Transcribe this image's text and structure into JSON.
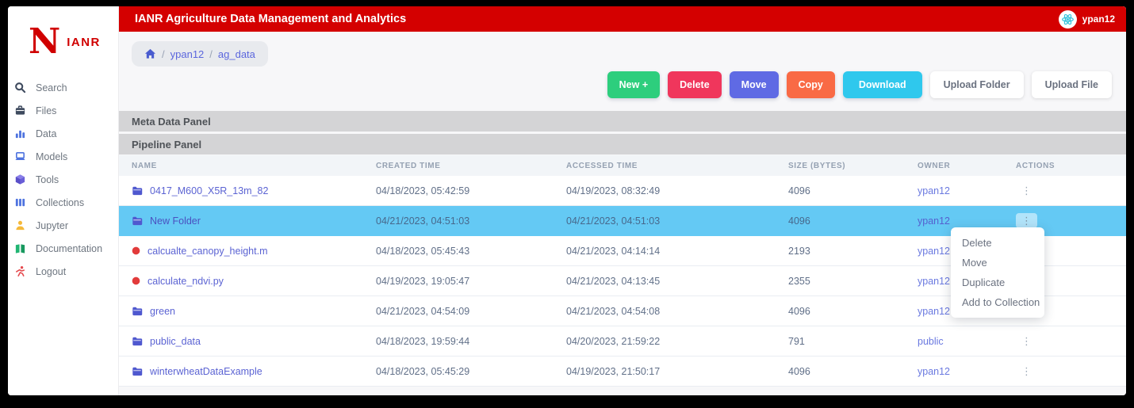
{
  "logo": {
    "letter": "N",
    "text": "IANR"
  },
  "header": {
    "title": "IANR Agriculture Data Management and Analytics",
    "username": "ypan12"
  },
  "sidebar": {
    "items": [
      {
        "icon": "search-icon",
        "label": "Search"
      },
      {
        "icon": "files-icon",
        "label": "Files"
      },
      {
        "icon": "data-icon",
        "label": "Data"
      },
      {
        "icon": "models-icon",
        "label": "Models"
      },
      {
        "icon": "tools-icon",
        "label": "Tools"
      },
      {
        "icon": "collections-icon",
        "label": "Collections"
      },
      {
        "icon": "jupyter-icon",
        "label": "Jupyter"
      },
      {
        "icon": "documentation-icon",
        "label": "Documentation"
      },
      {
        "icon": "logout-icon",
        "label": "Logout"
      }
    ]
  },
  "breadcrumb": {
    "sep": "/",
    "items": [
      "ypan12",
      "ag_data"
    ]
  },
  "toolbar": {
    "buttons": [
      {
        "label": "New +",
        "color": "#2dce7d"
      },
      {
        "label": "Delete",
        "color": "#f0365c"
      },
      {
        "label": "Move",
        "color": "#5f6ae4"
      },
      {
        "label": "Copy",
        "color": "#f96a45"
      },
      {
        "label": "Download",
        "color": "#2fc8ed"
      },
      {
        "label": "Upload Folder",
        "color": "#ffffff"
      },
      {
        "label": "Upload File",
        "color": "#ffffff"
      }
    ]
  },
  "panels": {
    "meta_label": "Meta Data Panel",
    "pipeline_label": "Pipeline Panel"
  },
  "table": {
    "columns": [
      "NAME",
      "CREATED TIME",
      "ACCESSED TIME",
      "SIZE (BYTES)",
      "OWNER",
      "ACTIONS"
    ],
    "rows": [
      {
        "name": "0417_M600_X5R_13m_82",
        "type": "folder",
        "created": "04/18/2023, 05:42:59",
        "accessed": "04/19/2023, 08:32:49",
        "size": "4096",
        "owner": "ypan12",
        "selected": false
      },
      {
        "name": "New Folder",
        "type": "folder",
        "created": "04/21/2023, 04:51:03",
        "accessed": "04/21/2023, 04:51:03",
        "size": "4096",
        "owner": "ypan12",
        "selected": true
      },
      {
        "name": "calcualte_canopy_height.m",
        "type": "file",
        "created": "04/18/2023, 05:45:43",
        "accessed": "04/21/2023, 04:14:14",
        "size": "2193",
        "owner": "ypan12",
        "selected": false
      },
      {
        "name": "calculate_ndvi.py",
        "type": "file",
        "created": "04/19/2023, 19:05:47",
        "accessed": "04/21/2023, 04:13:45",
        "size": "2355",
        "owner": "ypan12",
        "selected": false
      },
      {
        "name": "green",
        "type": "folder",
        "created": "04/21/2023, 04:54:09",
        "accessed": "04/21/2023, 04:54:08",
        "size": "4096",
        "owner": "ypan12",
        "selected": false
      },
      {
        "name": "public_data",
        "type": "folder",
        "created": "04/18/2023, 19:59:44",
        "accessed": "04/20/2023, 21:59:22",
        "size": "791",
        "owner": "public",
        "selected": false
      },
      {
        "name": "winterwheatDataExample",
        "type": "folder",
        "created": "04/18/2023, 05:45:29",
        "accessed": "04/19/2023, 21:50:17",
        "size": "4096",
        "owner": "ypan12",
        "selected": false
      }
    ]
  },
  "context_menu": {
    "items": [
      {
        "label": "Delete"
      },
      {
        "label": "Move"
      },
      {
        "label": "Duplicate"
      },
      {
        "label": "Add to Collection"
      }
    ]
  },
  "colors": {
    "brand_red": "#d40000",
    "selected_row": "#64c9f4",
    "link_blue": "#5b63d3",
    "folder_icon": "#4f58cf",
    "file_icon": "#e23b3b"
  }
}
